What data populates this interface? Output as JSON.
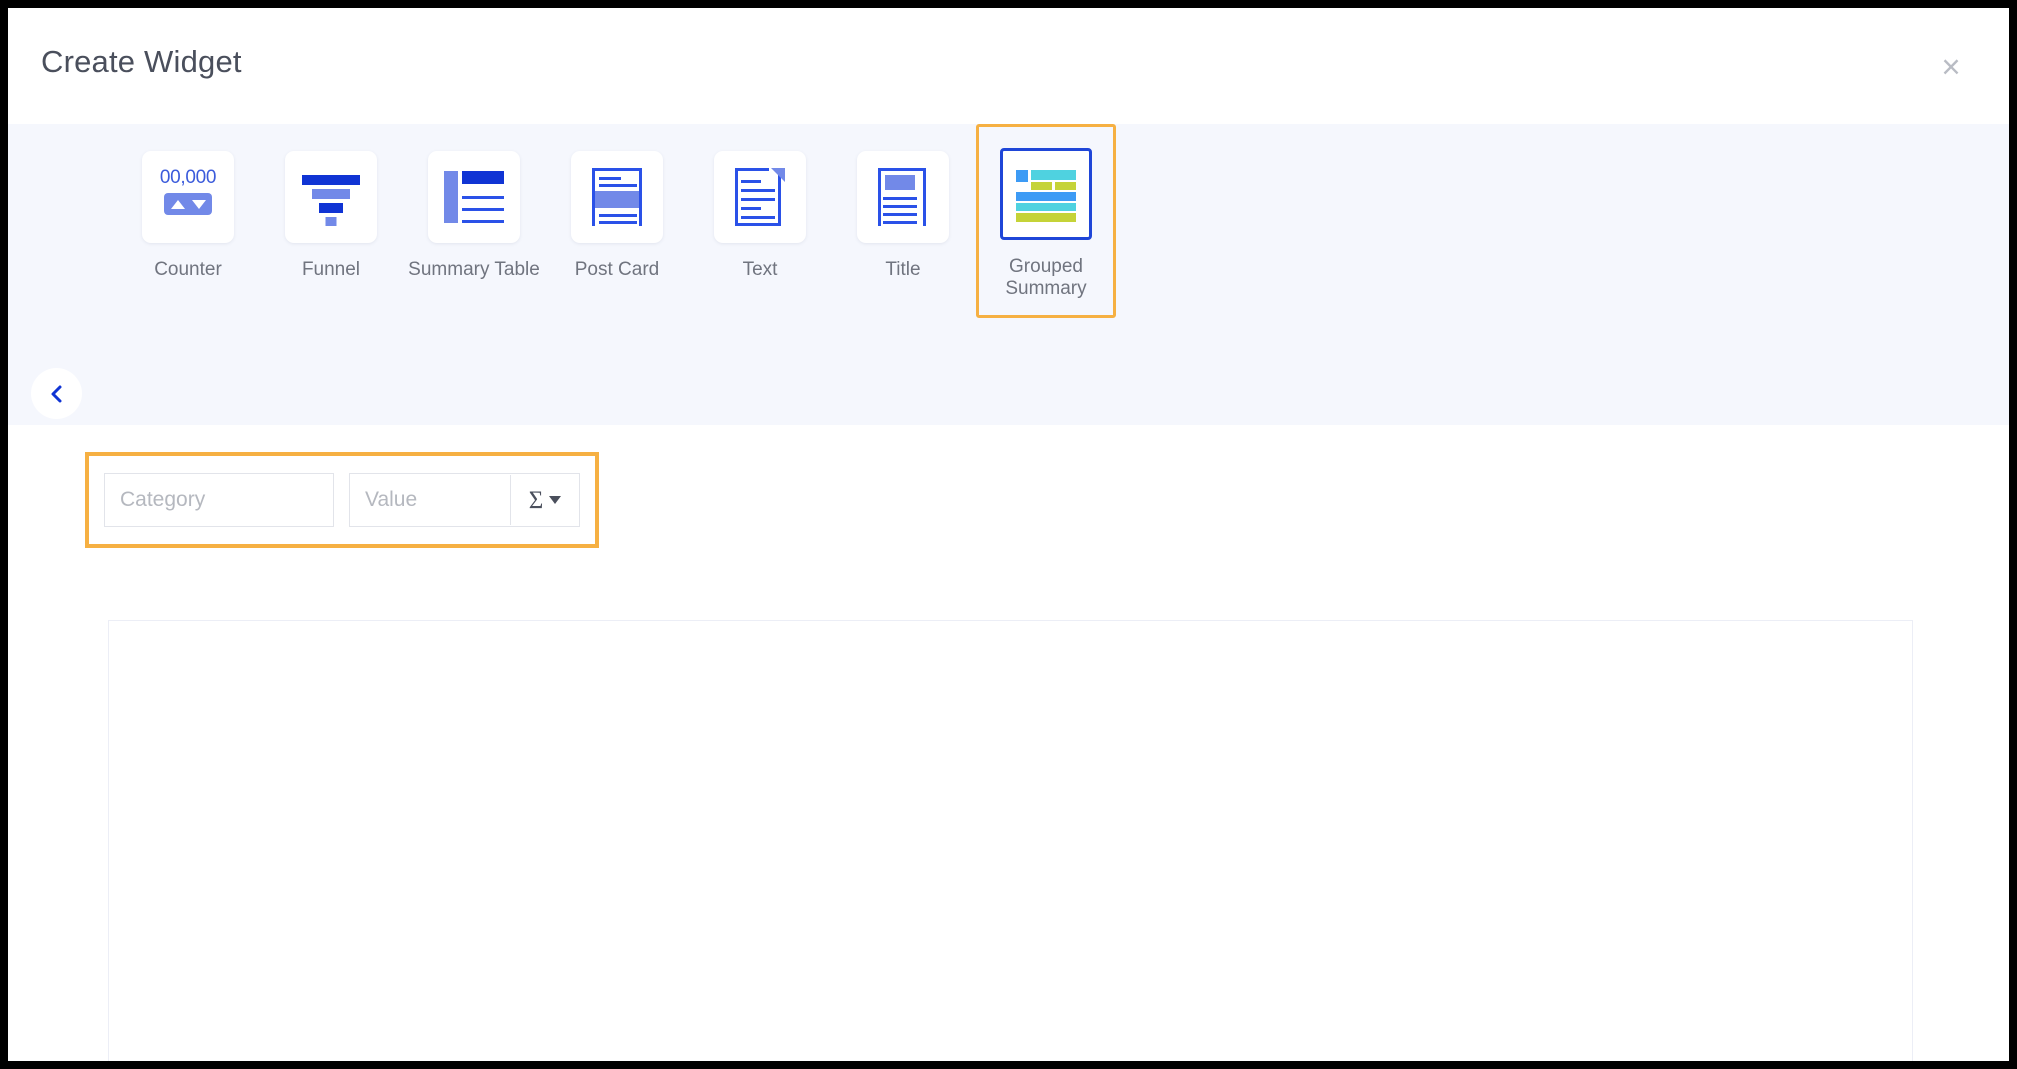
{
  "dialog": {
    "title": "Create Widget",
    "close_icon": "close-icon",
    "close_label": "×"
  },
  "type_picker": {
    "prev_arrow_icon": "chevron-left-icon",
    "items": [
      {
        "label": "Counter",
        "icon": "counter-icon",
        "selected": false,
        "highlighted": false,
        "counter_number": "00,000"
      },
      {
        "label": "Funnel",
        "icon": "funnel-icon",
        "selected": false,
        "highlighted": false
      },
      {
        "label": "Summary\nTable",
        "icon": "summary-table-icon",
        "selected": false,
        "highlighted": false
      },
      {
        "label": "Post Card",
        "icon": "post-card-icon",
        "selected": false,
        "highlighted": false
      },
      {
        "label": "Text",
        "icon": "text-icon",
        "selected": false,
        "highlighted": false
      },
      {
        "label": "Title",
        "icon": "title-icon",
        "selected": false,
        "highlighted": false
      },
      {
        "label": "Grouped\nSummary",
        "icon": "grouped-summary-icon",
        "selected": true,
        "highlighted": true
      }
    ]
  },
  "fields": {
    "category": {
      "value": "",
      "placeholder": "Category"
    },
    "value": {
      "value": "",
      "placeholder": "Value"
    },
    "aggregation": {
      "symbol": "Σ",
      "caret_icon": "caret-down-icon"
    }
  },
  "colors": {
    "highlight_orange": "#f6b042",
    "selection_blue": "#1f46d8",
    "band_background": "#f5f7fd",
    "icon_blue_dark": "#1034d4",
    "icon_blue_light": "#7289e8",
    "grouped_blue": "#3d9bf5",
    "grouped_cyan": "#4fd2e0",
    "grouped_yellow": "#c5d338",
    "label_gray": "#70747f",
    "title_gray": "#4a4f5c",
    "placeholder_gray": "#b5b8bf"
  }
}
